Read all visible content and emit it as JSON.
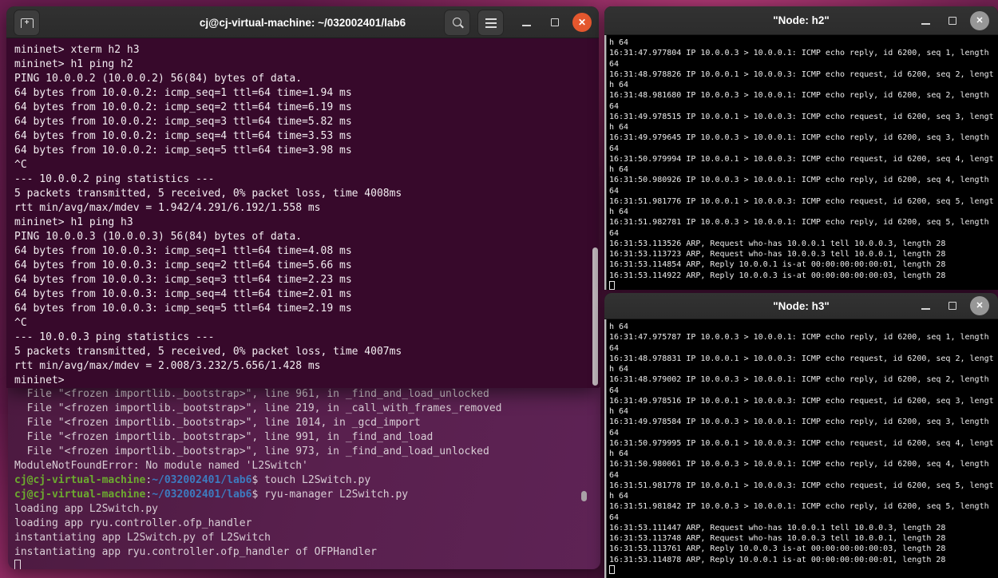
{
  "colors": {
    "accent_close_orange": "#e4572e",
    "terminal_bg": "#37092b",
    "ryu_terminal_bg": "#59204e",
    "xterm_bg": "#000000",
    "headerbar_bg": "#2e2e2e",
    "prompt_user_green": "#6cab2f",
    "prompt_path_blue": "#3d7bbf"
  },
  "icons": {
    "new_tab": "tab-plus",
    "search": "magnifier",
    "menu": "hamburger",
    "minimize": "dash",
    "maximize": "square-outline",
    "close": "x"
  },
  "main_terminal": {
    "title": "cj@cj-virtual-machine: ~/032002401/lab6",
    "new_tab_glyph": "+",
    "close_glyph": "✕",
    "lines": [
      "mininet> xterm h2 h3",
      "mininet> h1 ping h2",
      "PING 10.0.0.2 (10.0.0.2) 56(84) bytes of data.",
      "64 bytes from 10.0.0.2: icmp_seq=1 ttl=64 time=1.94 ms",
      "64 bytes from 10.0.0.2: icmp_seq=2 ttl=64 time=6.19 ms",
      "64 bytes from 10.0.0.2: icmp_seq=3 ttl=64 time=5.82 ms",
      "64 bytes from 10.0.0.2: icmp_seq=4 ttl=64 time=3.53 ms",
      "64 bytes from 10.0.0.2: icmp_seq=5 ttl=64 time=3.98 ms",
      "^C",
      "--- 10.0.0.2 ping statistics ---",
      "5 packets transmitted, 5 received, 0% packet loss, time 4008ms",
      "rtt min/avg/max/mdev = 1.942/4.291/6.192/1.558 ms",
      "mininet> h1 ping h3",
      "PING 10.0.0.3 (10.0.0.3) 56(84) bytes of data.",
      "64 bytes from 10.0.0.3: icmp_seq=1 ttl=64 time=4.08 ms",
      "64 bytes from 10.0.0.3: icmp_seq=2 ttl=64 time=5.66 ms",
      "64 bytes from 10.0.0.3: icmp_seq=3 ttl=64 time=2.23 ms",
      "64 bytes from 10.0.0.3: icmp_seq=4 ttl=64 time=2.01 ms",
      "64 bytes from 10.0.0.3: icmp_seq=5 ttl=64 time=2.19 ms",
      "^C",
      "--- 10.0.0.3 ping statistics ---",
      "5 packets transmitted, 5 received, 0% packet loss, time 4007ms",
      "rtt min/avg/max/mdev = 2.008/3.232/5.656/1.428 ms",
      "mininet> "
    ]
  },
  "ryu_terminal": {
    "traceback_lines": [
      "  File \"<frozen importlib._bootstrap>\", line 961, in _find_and_load_unlocked",
      "  File \"<frozen importlib._bootstrap>\", line 219, in _call_with_frames_removed",
      "  File \"<frozen importlib._bootstrap>\", line 1014, in _gcd_import",
      "  File \"<frozen importlib._bootstrap>\", line 991, in _find_and_load",
      "  File \"<frozen importlib._bootstrap>\", line 973, in _find_and_load_unlocked",
      "ModuleNotFoundError: No module named 'L2Switch'"
    ],
    "prompts": [
      {
        "user": "cj@cj-virtual-machine",
        "separator": ":",
        "path": "~/032002401/lab6",
        "prompt_symbol": "$",
        "command": " touch L2Switch.py"
      },
      {
        "user": "cj@cj-virtual-machine",
        "separator": ":",
        "path": "~/032002401/lab6",
        "prompt_symbol": "$",
        "command": " ryu-manager L2Switch.py"
      }
    ],
    "output_lines": [
      "loading app L2Switch.py",
      "loading app ryu.controller.ofp_handler",
      "instantiating app L2Switch.py of L2Switch",
      "instantiating app ryu.controller.ofp_handler of OFPHandler"
    ]
  },
  "xterm_h2": {
    "title": "\"Node: h2\"",
    "close_glyph": "✕",
    "lines": [
      "h 64",
      "16:31:47.977804 IP 10.0.0.3 > 10.0.0.1: ICMP echo reply, id 6200, seq 1, length",
      "64",
      "16:31:48.978826 IP 10.0.0.1 > 10.0.0.3: ICMP echo request, id 6200, seq 2, lengt",
      "h 64",
      "16:31:48.981680 IP 10.0.0.3 > 10.0.0.1: ICMP echo reply, id 6200, seq 2, length",
      "64",
      "16:31:49.978515 IP 10.0.0.1 > 10.0.0.3: ICMP echo request, id 6200, seq 3, lengt",
      "h 64",
      "16:31:49.979645 IP 10.0.0.3 > 10.0.0.1: ICMP echo reply, id 6200, seq 3, length",
      "64",
      "16:31:50.979994 IP 10.0.0.1 > 10.0.0.3: ICMP echo request, id 6200, seq 4, lengt",
      "h 64",
      "16:31:50.980926 IP 10.0.0.3 > 10.0.0.1: ICMP echo reply, id 6200, seq 4, length",
      "64",
      "16:31:51.981776 IP 10.0.0.1 > 10.0.0.3: ICMP echo request, id 6200, seq 5, lengt",
      "h 64",
      "16:31:51.982781 IP 10.0.0.3 > 10.0.0.1: ICMP echo reply, id 6200, seq 5, length",
      "64",
      "16:31:53.113526 ARP, Request who-has 10.0.0.1 tell 10.0.0.3, length 28",
      "16:31:53.113723 ARP, Request who-has 10.0.0.3 tell 10.0.0.1, length 28",
      "16:31:53.114854 ARP, Reply 10.0.0.1 is-at 00:00:00:00:00:01, length 28",
      "16:31:53.114922 ARP, Reply 10.0.0.3 is-at 00:00:00:00:00:03, length 28"
    ]
  },
  "xterm_h3": {
    "title": "\"Node: h3\"",
    "close_glyph": "✕",
    "lines": [
      "h 64",
      "16:31:47.975787 IP 10.0.0.3 > 10.0.0.1: ICMP echo reply, id 6200, seq 1, length",
      "64",
      "16:31:48.978831 IP 10.0.0.1 > 10.0.0.3: ICMP echo request, id 6200, seq 2, lengt",
      "h 64",
      "16:31:48.979002 IP 10.0.0.3 > 10.0.0.1: ICMP echo reply, id 6200, seq 2, length",
      "64",
      "16:31:49.978516 IP 10.0.0.1 > 10.0.0.3: ICMP echo request, id 6200, seq 3, lengt",
      "h 64",
      "16:31:49.978584 IP 10.0.0.3 > 10.0.0.1: ICMP echo reply, id 6200, seq 3, length",
      "64",
      "16:31:50.979995 IP 10.0.0.1 > 10.0.0.3: ICMP echo request, id 6200, seq 4, lengt",
      "h 64",
      "16:31:50.980061 IP 10.0.0.3 > 10.0.0.1: ICMP echo reply, id 6200, seq 4, length",
      "64",
      "16:31:51.981778 IP 10.0.0.1 > 10.0.0.3: ICMP echo request, id 6200, seq 5, lengt",
      "h 64",
      "16:31:51.981842 IP 10.0.0.3 > 10.0.0.1: ICMP echo reply, id 6200, seq 5, length",
      "64",
      "16:31:53.111447 ARP, Request who-has 10.0.0.1 tell 10.0.0.3, length 28",
      "16:31:53.113748 ARP, Request who-has 10.0.0.3 tell 10.0.0.1, length 28",
      "16:31:53.113761 ARP, Reply 10.0.0.3 is-at 00:00:00:00:00:03, length 28",
      "16:31:53.114878 ARP, Reply 10.0.0.1 is-at 00:00:00:00:00:01, length 28"
    ]
  }
}
